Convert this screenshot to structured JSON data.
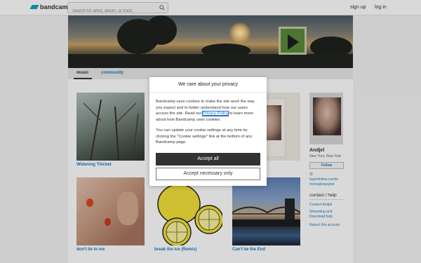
{
  "header": {
    "logo_text": "bandcamp",
    "search_placeholder": "Search for artist, album, or track",
    "signup_label": "sign up",
    "login_label": "log in"
  },
  "tabs": {
    "music": "music",
    "community": "community"
  },
  "albums": [
    {
      "title": "Widening Thicket"
    },
    {
      "title": "don't lie to me"
    },
    {
      "title": "break the ice (Remix)"
    },
    {
      "title": "Can't be the End"
    }
  ],
  "sidebar": {
    "artist_name": "Andjel",
    "location": "New York, New York",
    "follow_label": "Follow",
    "link_glyph": "Ⓓ",
    "link_line1": "hyperfollow.com/le",
    "link_line2": "monsalwaysjest",
    "contact_heading": "contact / help",
    "contact_link": "Contact Andjel",
    "streaming_line1": "Streaming and",
    "streaming_line2": "Download help",
    "report_link": "Report this account"
  },
  "cookie_modal": {
    "title": "We care about your privacy",
    "p1_before": "Bandcamp uses cookies to make the site work the way you expect and to better understand how our users access the site. Read our ",
    "p1_link": "Privacy Policy",
    "p1_after": " to learn more about how Bandcamp uses cookies.",
    "p2": "You can update your cookie settings at any time by clicking the \"Cookie settings\" link at the bottom of any Bandcamp page.",
    "accept_all": "Accept all",
    "accept_necessary": "Accept necessary only"
  },
  "colors": {
    "accent": "#1d7cc0",
    "logo": "#1da0c3",
    "dark_button": "#333333"
  }
}
